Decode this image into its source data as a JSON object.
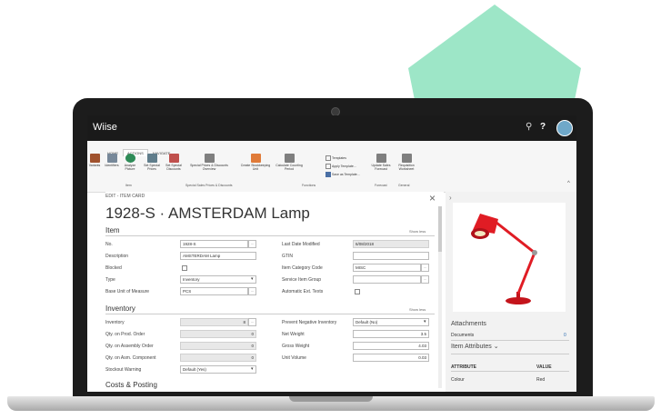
{
  "app": {
    "title": "Wiise",
    "help": "?"
  },
  "ribbon": {
    "tabs": [
      "HOME",
      "ACTIONS",
      "NAVIGATE"
    ],
    "actions": [
      {
        "label": "Variants",
        "icon": "variants-icon",
        "color": "#a0522d"
      },
      {
        "label": "Identifiers",
        "icon": "identifiers-icon",
        "color": "#778899"
      },
      {
        "label": "Analyze Picture",
        "icon": "refresh-icon",
        "color": "#2e8b57"
      },
      {
        "label": "Set Special Prices",
        "icon": "prices-icon",
        "color": "#607d8b"
      },
      {
        "label": "Set Special Discounts",
        "icon": "discounts-icon",
        "color": "#c0504d"
      },
      {
        "label": "Special Prices & Discounts Overview",
        "icon": "overview-icon",
        "color": "#7f7f7f"
      },
      {
        "label": "Create Stockkeeping Unit",
        "icon": "stockkeeping-icon",
        "color": "#e07b39"
      },
      {
        "label": "Calculate Counting Period",
        "icon": "counting-icon",
        "color": "#7f7f7f"
      },
      {
        "label": "Update Sales Forecast",
        "icon": "forecast-icon",
        "color": "#7f7f7f"
      },
      {
        "label": "Requisition Worksheet",
        "icon": "worksheet-icon",
        "color": "#7f7f7f"
      }
    ],
    "template_items": [
      "Templates",
      "Apply Template...",
      "Save as Template..."
    ],
    "groups": [
      "Item",
      "Special Sales Prices & Discounts",
      "Functions",
      "Forecast",
      "General"
    ]
  },
  "form": {
    "edit_label": "EDIT - ITEM CARD",
    "title": "1928-S · AMSTERDAM Lamp",
    "item_section": "Item",
    "show_less": "Show less",
    "item_left": [
      {
        "label": "No.",
        "value": "1928-S"
      },
      {
        "label": "Description",
        "value": "AMSTERDAM Lamp"
      },
      {
        "label": "Blocked",
        "value": ""
      },
      {
        "label": "Type",
        "value": "Inventory"
      },
      {
        "label": "Base Unit of Measure",
        "value": "PCS"
      }
    ],
    "item_right": [
      {
        "label": "Last Date Modified",
        "value": "6/08/2018"
      },
      {
        "label": "GTIN",
        "value": ""
      },
      {
        "label": "Item Category Code",
        "value": "MISC"
      },
      {
        "label": "Service Item Group",
        "value": ""
      },
      {
        "label": "Automatic Ext. Texts",
        "value": ""
      }
    ],
    "inventory_section": "Inventory",
    "inv_left": [
      {
        "label": "Inventory",
        "value": "8"
      },
      {
        "label": "Qty. on Prod. Order",
        "value": "0"
      },
      {
        "label": "Qty. on Assembly Order",
        "value": "0"
      },
      {
        "label": "Qty. on Asm. Component",
        "value": "0"
      },
      {
        "label": "Stockout Warning",
        "value": "Default (Yes)"
      }
    ],
    "inv_right": [
      {
        "label": "Prevent Negative Inventory",
        "value": "Default (No)"
      },
      {
        "label": "Net Weight",
        "value": "3.5"
      },
      {
        "label": "Gross Weight",
        "value": "4.03"
      },
      {
        "label": "Unit Volume",
        "value": "0.03"
      }
    ],
    "next_section": "Costs & Posting"
  },
  "pane": {
    "attachments": "Attachments",
    "documents_label": "Documents",
    "documents_count": "0",
    "item_attributes": "Item Attributes",
    "col_attribute": "ATTRIBUTE",
    "col_value": "VALUE",
    "attr_name": "Colour",
    "attr_value": "Red"
  },
  "colors": {
    "brand_shape": "#9de6c7",
    "lamp": "#e01c24",
    "topbar": "#1a1a1a"
  }
}
